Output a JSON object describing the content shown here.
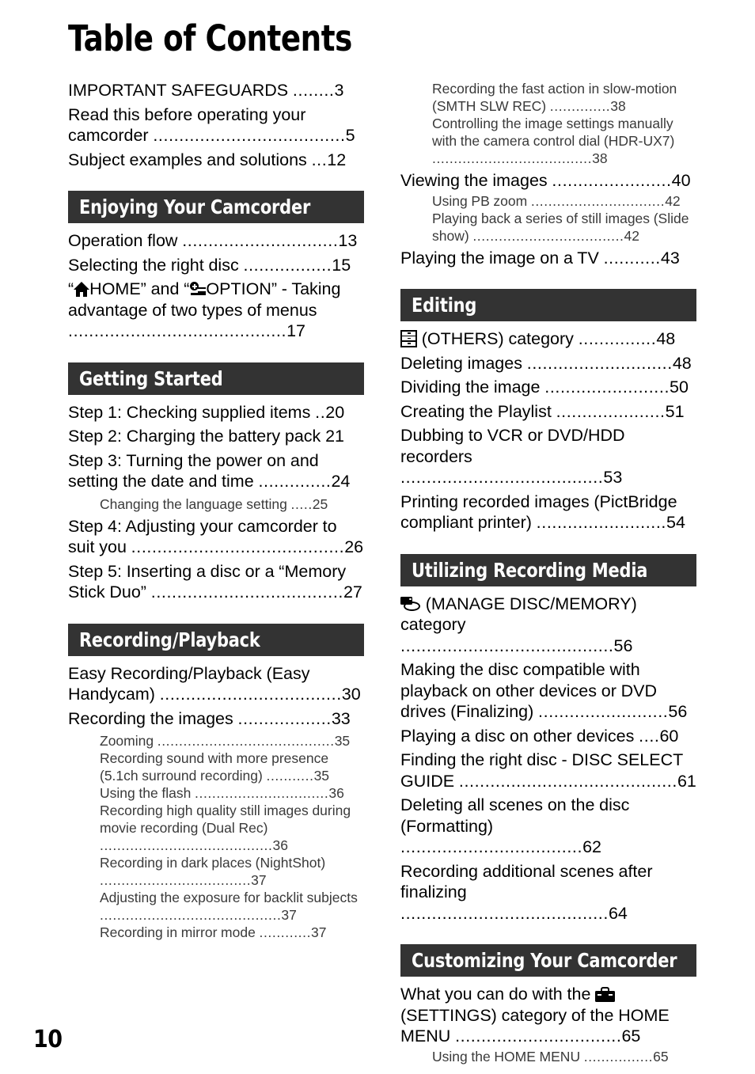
{
  "page": {
    "title": "Table of Contents",
    "folio": "10",
    "band_color": "#333333",
    "text_color": "#000000",
    "background": "#ffffff"
  },
  "icons": {
    "home": "home-icon",
    "option": "option-icon",
    "others": "others-category-icon",
    "manage_disc": "manage-disc-memory-icon",
    "settings": "settings-toolbox-icon"
  },
  "left_column": {
    "intro_entries": [
      {
        "text": "IMPORTANT SAFEGUARDS ",
        "dots": "........",
        "page": "3",
        "level": "main"
      },
      {
        "text": "Read this before operating your camcorder ",
        "dots": ".....................................",
        "page": "5",
        "level": "main"
      },
      {
        "text": "Subject examples and solutions ",
        "dots": "...",
        "page": "12",
        "level": "main"
      }
    ],
    "sections": [
      {
        "band": "Enjoying Your Camcorder",
        "entries": [
          {
            "text": "Operation flow ",
            "dots": "..............................",
            "page": "13",
            "level": "main"
          },
          {
            "text": "Selecting the right disc ",
            "dots": ".................",
            "page": "15",
            "level": "main"
          },
          {
            "text_pre": "“",
            "icon": "home",
            "text_mid": "HOME” and “",
            "icon2": "option",
            "text_post": "OPTION”\n- Taking advantage of two types of menus ",
            "dots": "..........................................",
            "page": "17",
            "level": "main-icon-home-option"
          }
        ]
      },
      {
        "band": "Getting Started",
        "entries": [
          {
            "text": "Step 1: Checking supplied items ",
            "dots": "..",
            "page": "20",
            "level": "main"
          },
          {
            "text": "Step 2: Charging the battery pack ",
            "dots": "",
            "page": "21",
            "level": "main"
          },
          {
            "text": "Step 3: Turning the power on and setting the date and time ",
            "dots": "..............",
            "page": "24",
            "level": "main"
          },
          {
            "text": "Changing the language setting ",
            "dots": ".....",
            "page": "25",
            "level": "sub"
          },
          {
            "text": "Step 4: Adjusting your camcorder to suit you ",
            "dots": ".........................................",
            "page": "26",
            "level": "main"
          },
          {
            "text": "Step 5: Inserting a disc or a “Memory Stick Duo” ",
            "dots": ".....................................",
            "page": "27",
            "level": "main"
          }
        ]
      },
      {
        "band": "Recording/Playback",
        "entries": [
          {
            "text": "Easy Recording/Playback (Easy Handycam) ",
            "dots": "...................................",
            "page": "30",
            "level": "main"
          },
          {
            "text": "Recording the images ",
            "dots": "..................",
            "page": "33",
            "level": "main"
          },
          {
            "text": "Zooming ",
            "dots": ".........................................",
            "page": "35",
            "level": "sub"
          },
          {
            "text": "Recording sound with more presence (5.1ch surround recording) ",
            "dots": "...........",
            "page": "35",
            "level": "sub"
          },
          {
            "text": "Using the flash ",
            "dots": "...............................",
            "page": "36",
            "level": "sub"
          },
          {
            "text": "Recording high quality still images during movie recording (Dual Rec)",
            "dots": " ........................................",
            "page": "36",
            "level": "sub"
          },
          {
            "text": "Recording in dark places (NightShot) ",
            "dots": "...................................",
            "page": "37",
            "level": "sub"
          },
          {
            "text": "Adjusting the exposure for backlit subjects ",
            "dots": "..........................................",
            "page": "37",
            "level": "sub"
          },
          {
            "text": "Recording in mirror mode ",
            "dots": "............",
            "page": "37",
            "level": "sub"
          }
        ]
      }
    ]
  },
  "right_column": {
    "continued_entries": [
      {
        "text": "Recording the fast action in slow-motion (SMTH SLW REC) ",
        "dots": "..............",
        "page": "38",
        "level": "sub"
      },
      {
        "text": "Controlling the image settings manually with the camera control dial (HDR-UX7) ",
        "dots": ".....................................",
        "page": "38",
        "level": "sub"
      },
      {
        "text": "Viewing the images ",
        "dots": ".......................",
        "page": "40",
        "level": "main"
      },
      {
        "text": "Using PB zoom ",
        "dots": "...............................",
        "page": "42",
        "level": "sub"
      },
      {
        "text": "Playing back a series of still images (Slide show) ",
        "dots": "...................................",
        "page": "42",
        "level": "sub"
      },
      {
        "text": "Playing the image on a TV ",
        "dots": "...........",
        "page": "43",
        "level": "main"
      }
    ],
    "sections": [
      {
        "band": "Editing",
        "entries": [
          {
            "icon": "others",
            "text": " (OTHERS) category ",
            "dots": "...............",
            "page": "48",
            "level": "main-icon"
          },
          {
            "text": "Deleting images ",
            "dots": "............................",
            "page": "48",
            "level": "main"
          },
          {
            "text": "Dividing the image ",
            "dots": "........................",
            "page": "50",
            "level": "main"
          },
          {
            "text": "Creating the Playlist ",
            "dots": ".....................",
            "page": "51",
            "level": "main"
          },
          {
            "text": "Dubbing to VCR or DVD/HDD recorders ",
            "dots": ".......................................",
            "page": "53",
            "level": "main"
          },
          {
            "text": "Printing recorded images (PictBridge compliant printer) ",
            "dots": ".........................",
            "page": "54",
            "level": "main"
          }
        ]
      },
      {
        "band": "Utilizing Recording Media",
        "entries": [
          {
            "icon": "manage_disc",
            "text": " (MANAGE DISC/MEMORY) category ",
            "dots": ".........................................",
            "page": "56",
            "level": "main-icon"
          },
          {
            "text": "Making the disc compatible with playback on other devices or DVD drives (Finalizing) ",
            "dots": ".........................",
            "page": "56",
            "level": "main"
          },
          {
            "text": "Playing a disc on other devices ",
            "dots": "....",
            "page": "60",
            "level": "main"
          },
          {
            "text": "Finding the right disc - DISC SELECT GUIDE ",
            "dots": "..........................................",
            "page": "61",
            "level": "main"
          },
          {
            "text": "Deleting all scenes on the disc (Formatting) ",
            "dots": "...................................",
            "page": "62",
            "level": "main"
          },
          {
            "text": "Recording additional scenes after finalizing ",
            "dots": "........................................",
            "page": "64",
            "level": "main"
          }
        ]
      },
      {
        "band": "Customizing Your Camcorder",
        "entries": [
          {
            "text_pre": "What you can do with the\n",
            "icon": "settings",
            "text_post": " (SETTINGS) category of the HOME MENU ",
            "dots": "................................",
            "page": "65",
            "level": "main-icon-settings"
          },
          {
            "text": "Using the HOME MENU ",
            "dots": "................",
            "page": "65",
            "level": "sub"
          }
        ]
      }
    ]
  }
}
